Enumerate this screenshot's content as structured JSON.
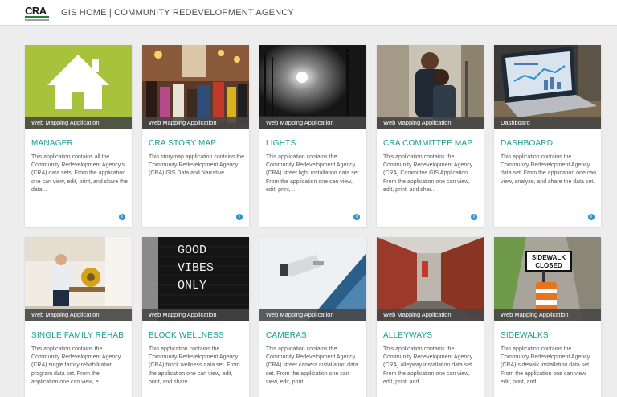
{
  "header": {
    "logo_text": "CRA",
    "title": "GIS HOME | COMMUNITY REDEVELOPMENT AGENCY"
  },
  "colors": {
    "accent": "#1a9b8f",
    "info": "#2b93d1",
    "type_bar": "#464646"
  },
  "cards": [
    {
      "type": "Web Mapping Application",
      "title": "MANAGER",
      "description": "This application contains all the Community Redevelopment Agency's (CRA) data sets. From the application one can view, edit, print, and share the data...",
      "icon": "house-icon"
    },
    {
      "type": "Web Mapping Application",
      "title": "CRA STORY MAP",
      "description": "This storymap application contains the Community Redevelopment Agency (CRA) GIS Data and Narrative.",
      "icon": "crowd-photo"
    },
    {
      "type": "Web Mapping Application",
      "title": "LIGHTS",
      "description": "This application contains the Community Redevelopment Agency (CRA) street light installation data set. From the application one can view, edit, print, ...",
      "icon": "street-light-photo"
    },
    {
      "type": "Web Mapping Application",
      "title": "CRA COMMITTEE MAP",
      "description": "This application contains the Community Redevelopment Agency (CRA) Committee GIS Application. From the application one can view, edit, print, and shar...",
      "icon": "couple-photo"
    },
    {
      "type": "Dashboard",
      "title": "DASHBOARD",
      "description": "This application contains the Community Redevelopment Agency data set. From the application one can view, analyze, and share the data set.",
      "icon": "laptop-photo"
    },
    {
      "type": "Web Mapping Application",
      "title": "SINGLE FAMILY REHAB",
      "description": "This application contains the Community Redevelopment Agency (CRA) single family rehabilitation program data set. From the application one can view, e...",
      "icon": "worker-photo"
    },
    {
      "type": "Web Mapping Application",
      "title": "BLOCK WELLNESS",
      "description": "This application contains the Community Redevelopment Agency (CRA) block wellness data set. From the application one can view, edit, print, and share ...",
      "icon": "letterboard-photo",
      "sign_lines": [
        "GOOD",
        "VIBES",
        "ONLY"
      ]
    },
    {
      "type": "Web Mapping Application",
      "title": "CAMERAS",
      "description": "This application contains the Community Redevelopment Agency (CRA) street camera installation data set. From the application one can view, edit, print...",
      "icon": "camera-photo"
    },
    {
      "type": "Web Mapping Application",
      "title": "ALLEYWAYS",
      "description": "This application contains the Community Redevelopment Agency (CRA) alleyway installation data set. From the application one can view, edit, print, and...",
      "icon": "alley-photo"
    },
    {
      "type": "Web Mapping Application",
      "title": "SIDEWALKS",
      "description": "This application contains the Community Redevelopment Agency (CRA) sidewalk installation data set. From the application one can view, edit, print, and...",
      "icon": "sidewalk-photo",
      "sign_lines": [
        "SIDEWALK",
        "CLOSED"
      ]
    }
  ]
}
